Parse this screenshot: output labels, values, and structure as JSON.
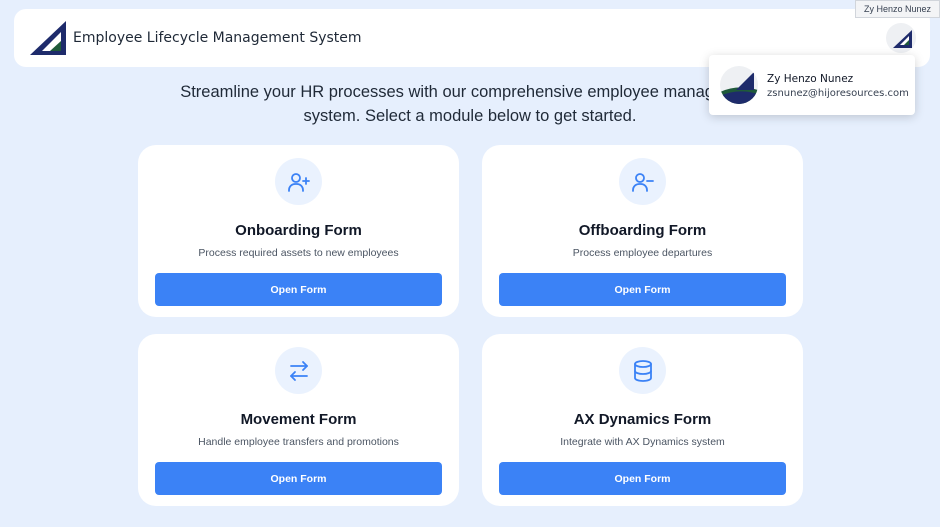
{
  "tooltip": {
    "text": "Zy Henzo Nunez"
  },
  "header": {
    "title": "Employee Lifecycle Management System"
  },
  "profile": {
    "name": "Zy Henzo Nunez",
    "email": "zsnunez@hijoresources.com"
  },
  "intro": {
    "text": "Streamline your HR processes with our comprehensive employee management system. Select a module below to get started."
  },
  "colors": {
    "accent": "#3b82f6",
    "background": "#e6effd",
    "logo_navy": "#1e2b6b",
    "logo_green": "#1f5a3a"
  },
  "modules": [
    {
      "icon": "user-plus-icon",
      "title": "Onboarding Form",
      "description": "Process required assets to new employees",
      "button": "Open Form"
    },
    {
      "icon": "user-minus-icon",
      "title": "Offboarding Form",
      "description": "Process employee departures",
      "button": "Open Form"
    },
    {
      "icon": "arrows-exchange-icon",
      "title": "Movement Form",
      "description": "Handle employee transfers and promotions",
      "button": "Open Form"
    },
    {
      "icon": "database-icon",
      "title": "AX Dynamics Form",
      "description": "Integrate with AX Dynamics system",
      "button": "Open Form"
    }
  ]
}
